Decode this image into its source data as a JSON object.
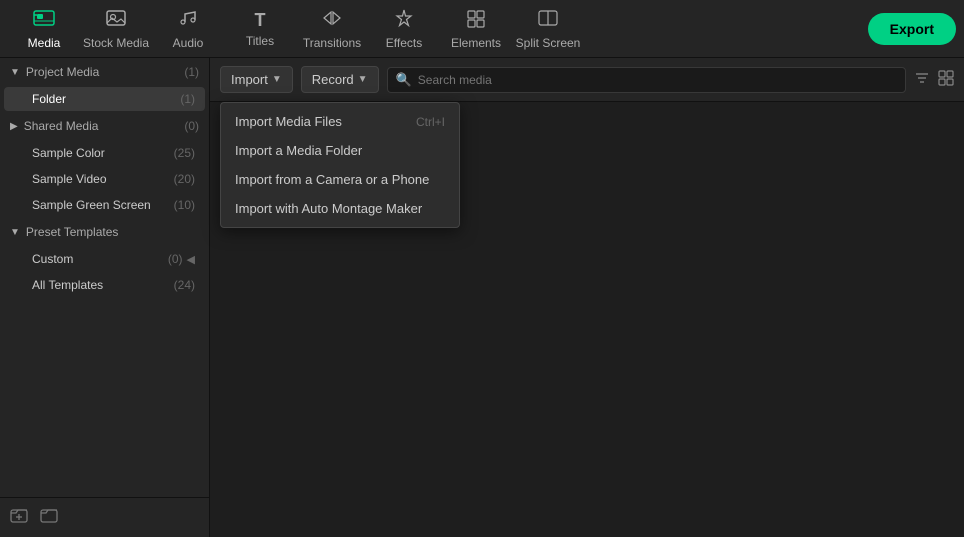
{
  "nav": {
    "items": [
      {
        "id": "media",
        "label": "Media",
        "icon": "🎞",
        "active": true
      },
      {
        "id": "stock-media",
        "label": "Stock Media",
        "icon": "🖼"
      },
      {
        "id": "audio",
        "label": "Audio",
        "icon": "🎵"
      },
      {
        "id": "titles",
        "label": "Titles",
        "icon": "T"
      },
      {
        "id": "transitions",
        "label": "Transitions",
        "icon": "⟷"
      },
      {
        "id": "effects",
        "label": "Effects",
        "icon": "✦"
      },
      {
        "id": "elements",
        "label": "Elements",
        "icon": "◈"
      },
      {
        "id": "split-screen",
        "label": "Split Screen",
        "icon": "⊞"
      }
    ],
    "export_label": "Export"
  },
  "toolbar": {
    "import_label": "Import",
    "record_label": "Record",
    "search_placeholder": "Search media"
  },
  "dropdown": {
    "items": [
      {
        "id": "import-files",
        "label": "Import Media Files",
        "shortcut": "Ctrl+I"
      },
      {
        "id": "import-folder",
        "label": "Import a Media Folder",
        "shortcut": ""
      },
      {
        "id": "import-camera",
        "label": "Import from a Camera or a Phone",
        "shortcut": ""
      },
      {
        "id": "import-auto-montage",
        "label": "Import with Auto Montage Maker",
        "shortcut": ""
      }
    ]
  },
  "sidebar": {
    "project_media_label": "Project Media",
    "project_media_count": "(1)",
    "folder_label": "Folder",
    "folder_count": "(1)",
    "shared_media_label": "Shared Media",
    "shared_media_count": "(0)",
    "sample_color_label": "Sample Color",
    "sample_color_count": "(25)",
    "sample_video_label": "Sample Video",
    "sample_video_count": "(20)",
    "sample_green_label": "Sample Green Screen",
    "sample_green_count": "(10)",
    "preset_templates_label": "Preset Templates",
    "custom_label": "Custom",
    "custom_count": "(0)",
    "all_templates_label": "All Templates",
    "all_templates_count": "(24)"
  },
  "media_items": [
    {
      "id": "thumb1",
      "type": "video",
      "has_icon": true,
      "has_check": false
    },
    {
      "id": "thumb2",
      "type": "video",
      "has_icon": false,
      "has_check": true
    }
  ]
}
